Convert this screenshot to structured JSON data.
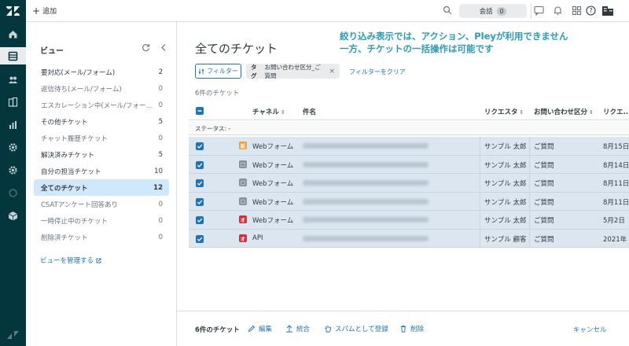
{
  "topbar": {
    "add_label": "追加",
    "conversations_label": "会話",
    "conversations_count": "0"
  },
  "views": {
    "title": "ビュー",
    "items": [
      {
        "label": "要対応(メール/フォーム)",
        "count": "2",
        "dim": false
      },
      {
        "label": "返信待ち(メール/フォーム)",
        "count": "0",
        "dim": true
      },
      {
        "label": "エスカレーション中(メール/フォー...",
        "count": "0",
        "dim": true
      },
      {
        "label": "その他チケット",
        "count": "5",
        "dim": false
      },
      {
        "label": "チャット履歴チケット",
        "count": "0",
        "dim": true
      },
      {
        "label": "解決済みチケット",
        "count": "5",
        "dim": false
      },
      {
        "label": "自分の担当チケット",
        "count": "10",
        "dim": false
      },
      {
        "label": "全てのチケット",
        "count": "12",
        "dim": false,
        "active": true
      },
      {
        "label": "CSATアンケート回答あり",
        "count": "0",
        "dim": true
      },
      {
        "label": "一時停止中のチケット",
        "count": "0",
        "dim": true
      },
      {
        "label": "削除済チケット",
        "count": "0",
        "dim": true
      }
    ],
    "manage_label": "ビューを管理する"
  },
  "main": {
    "title": "全てのチケット",
    "notice_line1": "絞り込み表示では、アクション、Pleyが利用できません",
    "notice_line2": "一方、チケットの一括操作は可能です",
    "filter_label": "フィルター",
    "tag_chip_key": "タグ",
    "tag_chip_value": "お問い合わせ区分_ご質問",
    "clear_filter_label": "フィルターをクリア",
    "ticket_count_label": "6件のチケット"
  },
  "table": {
    "headers": {
      "channel": "チャネル",
      "subject": "件名",
      "requester": "リクエスタ",
      "category": "お問い合わせ区分",
      "requested": "リクエ..."
    },
    "status_group": "ステータス: -",
    "rows": [
      {
        "channel_icon": "web-form-orange",
        "channel": "Webフォーム",
        "requester": "サンプル 太郎",
        "category": "ご質問",
        "date": "8月15日"
      },
      {
        "channel_icon": "web-form-gray",
        "channel": "Webフォーム",
        "requester": "サンプル 太郎",
        "category": "ご質問",
        "date": "8月14日"
      },
      {
        "channel_icon": "web-form-gray",
        "channel": "Webフォーム",
        "requester": "サンプル 太郎",
        "category": "ご質問",
        "date": "8月11日"
      },
      {
        "channel_icon": "web-form-gray",
        "channel": "Webフォーム",
        "requester": "サンプル 太郎",
        "category": "ご質問",
        "date": "8月11日"
      },
      {
        "channel_icon": "web-form-red",
        "channel": "Webフォーム",
        "requester": "サンプル 太郎",
        "category": "ご質問",
        "date": "5月2日"
      },
      {
        "channel_icon": "api-red",
        "channel": "API",
        "requester": "サンプル 顧客",
        "category": "ご質問",
        "date": "2021年"
      }
    ]
  },
  "bulk_bar": {
    "count_label": "6件のチケット",
    "edit_label": "編集",
    "merge_label": "統合",
    "spam_label": "スパムとして登録",
    "delete_label": "削除",
    "cancel_label": "キャンセル"
  },
  "colors": {
    "rail": "#03363d",
    "accent": "#1f73b7",
    "notice": "#2b9bb3",
    "selected_row": "#dbe6f0",
    "active_view": "#d1e8fa"
  }
}
